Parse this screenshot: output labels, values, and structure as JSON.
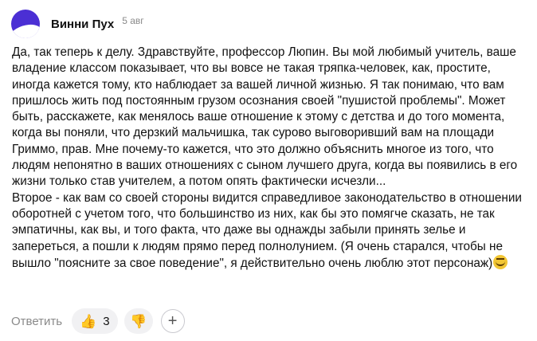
{
  "comment": {
    "author": "Винни Пух",
    "date": "5 авг",
    "text_p1": "Да, так теперь к делу. Здравствуйте, профессор Люпин. Вы мой любимый учитель, ваше владение классом показывает, что вы вовсе не такая тряпка-человек, как, простите, иногда кажется тому, кто наблюдает за вашей личной жизнью. Я так понимаю, что вам пришлось жить под постоянным грузом осознания своей \"пушистой проблемы\". Может быть, расскажете, как менялось ваше отношение к этому с детства и до того момента, когда вы поняли, что дерзкий мальчишка, так сурово выговоривший вам на площади Гриммо, прав. Мне почему-то кажется, что это должно объяснить многое из того, что людям непонятно в ваших отношениях с сыном лучшего друга, когда вы появились в его жизни только став учителем, а потом опять фактически исчезли...",
    "text_p2": "Второе - как вам со своей стороны видится справедливое законодательство в отношении оборотней с учетом того, что большинство из них, как бы это помягче сказать, не так эмпатичны, как вы, и того факта, что даже вы однажды забыли принять зелье и запереться, а пошли к людям прямо перед полнолунием. (Я очень старался, чтобы не вышло \"поясните за свое поведение\", я действительно очень люблю этот персонаж)",
    "end_emoji": "grinning-sweat-emoji"
  },
  "actions": {
    "reply_label": "Ответить",
    "like_icon": "thumbs-up-icon",
    "like_count": "3",
    "dislike_icon": "thumbs-down-icon",
    "add_reaction_icon": "plus-icon",
    "add_reaction_symbol": "+"
  }
}
